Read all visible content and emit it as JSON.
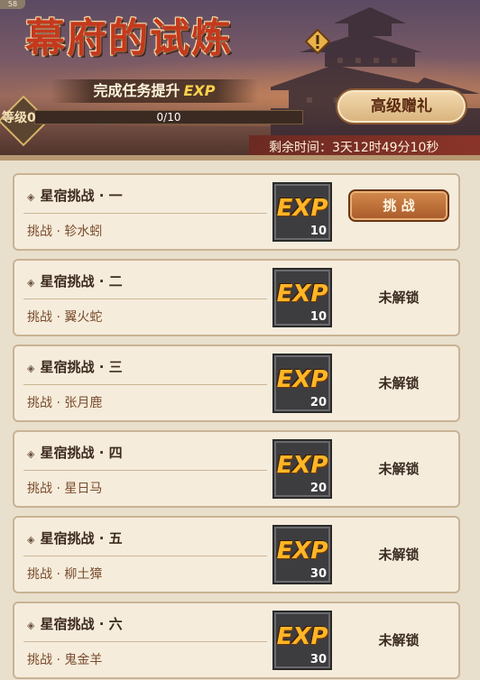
{
  "header": {
    "corner_badge": "58",
    "title": "幕府的试炼",
    "subtitle_text": "完成任务提升",
    "subtitle_exp": "EXP",
    "level_label": "等级0",
    "progress_text": "0/10",
    "progress_fraction": 0.0,
    "gift_button": "高级赠礼",
    "timer_text": "剩余时间：3天12时49分10秒",
    "warning_icon": "exclamation-diamond-icon"
  },
  "colors": {
    "title_red": "#c4391c",
    "exp_gold": "#ffb627",
    "card_bg": "#f5ecdc",
    "button_orange": "#c47a3e"
  },
  "challenges": [
    {
      "name": "星宿挑战 · 一",
      "sub": "挑战 · 轸水蚓",
      "exp_label": "EXP",
      "exp_value": "10",
      "action": "挑 战",
      "status": "available"
    },
    {
      "name": "星宿挑战 · 二",
      "sub": "挑战 · 翼火蛇",
      "exp_label": "EXP",
      "exp_value": "10",
      "action": "未解锁",
      "status": "locked"
    },
    {
      "name": "星宿挑战 · 三",
      "sub": "挑战 · 张月鹿",
      "exp_label": "EXP",
      "exp_value": "20",
      "action": "未解锁",
      "status": "locked"
    },
    {
      "name": "星宿挑战 · 四",
      "sub": "挑战 · 星日马",
      "exp_label": "EXP",
      "exp_value": "20",
      "action": "未解锁",
      "status": "locked"
    },
    {
      "name": "星宿挑战 · 五",
      "sub": "挑战 · 柳土獐",
      "exp_label": "EXP",
      "exp_value": "30",
      "action": "未解锁",
      "status": "locked"
    },
    {
      "name": "星宿挑战 · 六",
      "sub": "挑战 · 鬼金羊",
      "exp_label": "EXP",
      "exp_value": "30",
      "action": "未解锁",
      "status": "locked"
    }
  ]
}
